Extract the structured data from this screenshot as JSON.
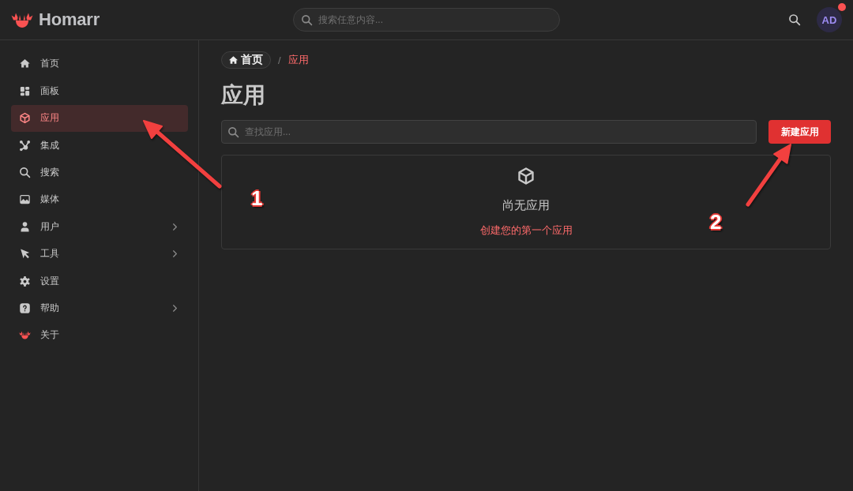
{
  "header": {
    "logo_text": "Homarr",
    "search": {
      "placeholder": "搜索任意内容..."
    },
    "avatar": {
      "initials": "AD",
      "notification": true
    }
  },
  "sidebar": {
    "items": [
      {
        "label": "首页",
        "selected": false,
        "expandable": false
      },
      {
        "label": "面板",
        "selected": false,
        "expandable": false
      },
      {
        "label": "应用",
        "selected": true,
        "expandable": false
      },
      {
        "label": "集成",
        "selected": false,
        "expandable": false
      },
      {
        "label": "搜索",
        "selected": false,
        "expandable": false
      },
      {
        "label": "媒体",
        "selected": false,
        "expandable": false
      },
      {
        "label": "用户",
        "selected": false,
        "expandable": true
      },
      {
        "label": "工具",
        "selected": false,
        "expandable": true
      },
      {
        "label": "设置",
        "selected": false,
        "expandable": false
      },
      {
        "label": "帮助",
        "selected": false,
        "expandable": true
      },
      {
        "label": "关于",
        "selected": false,
        "expandable": false
      }
    ]
  },
  "breadcrumb": {
    "separator": "/",
    "items": [
      {
        "kind": "home",
        "label": "首页"
      },
      {
        "kind": "current",
        "label": "应用"
      }
    ]
  },
  "page": {
    "title": "应用",
    "search": {
      "placeholder": "查找应用..."
    },
    "new_button": "新建应用",
    "empty_state": {
      "title": "尚无应用",
      "link": "创建您的第一个应用"
    }
  },
  "annotations": [
    {
      "number": "1"
    },
    {
      "number": "2"
    }
  ]
}
